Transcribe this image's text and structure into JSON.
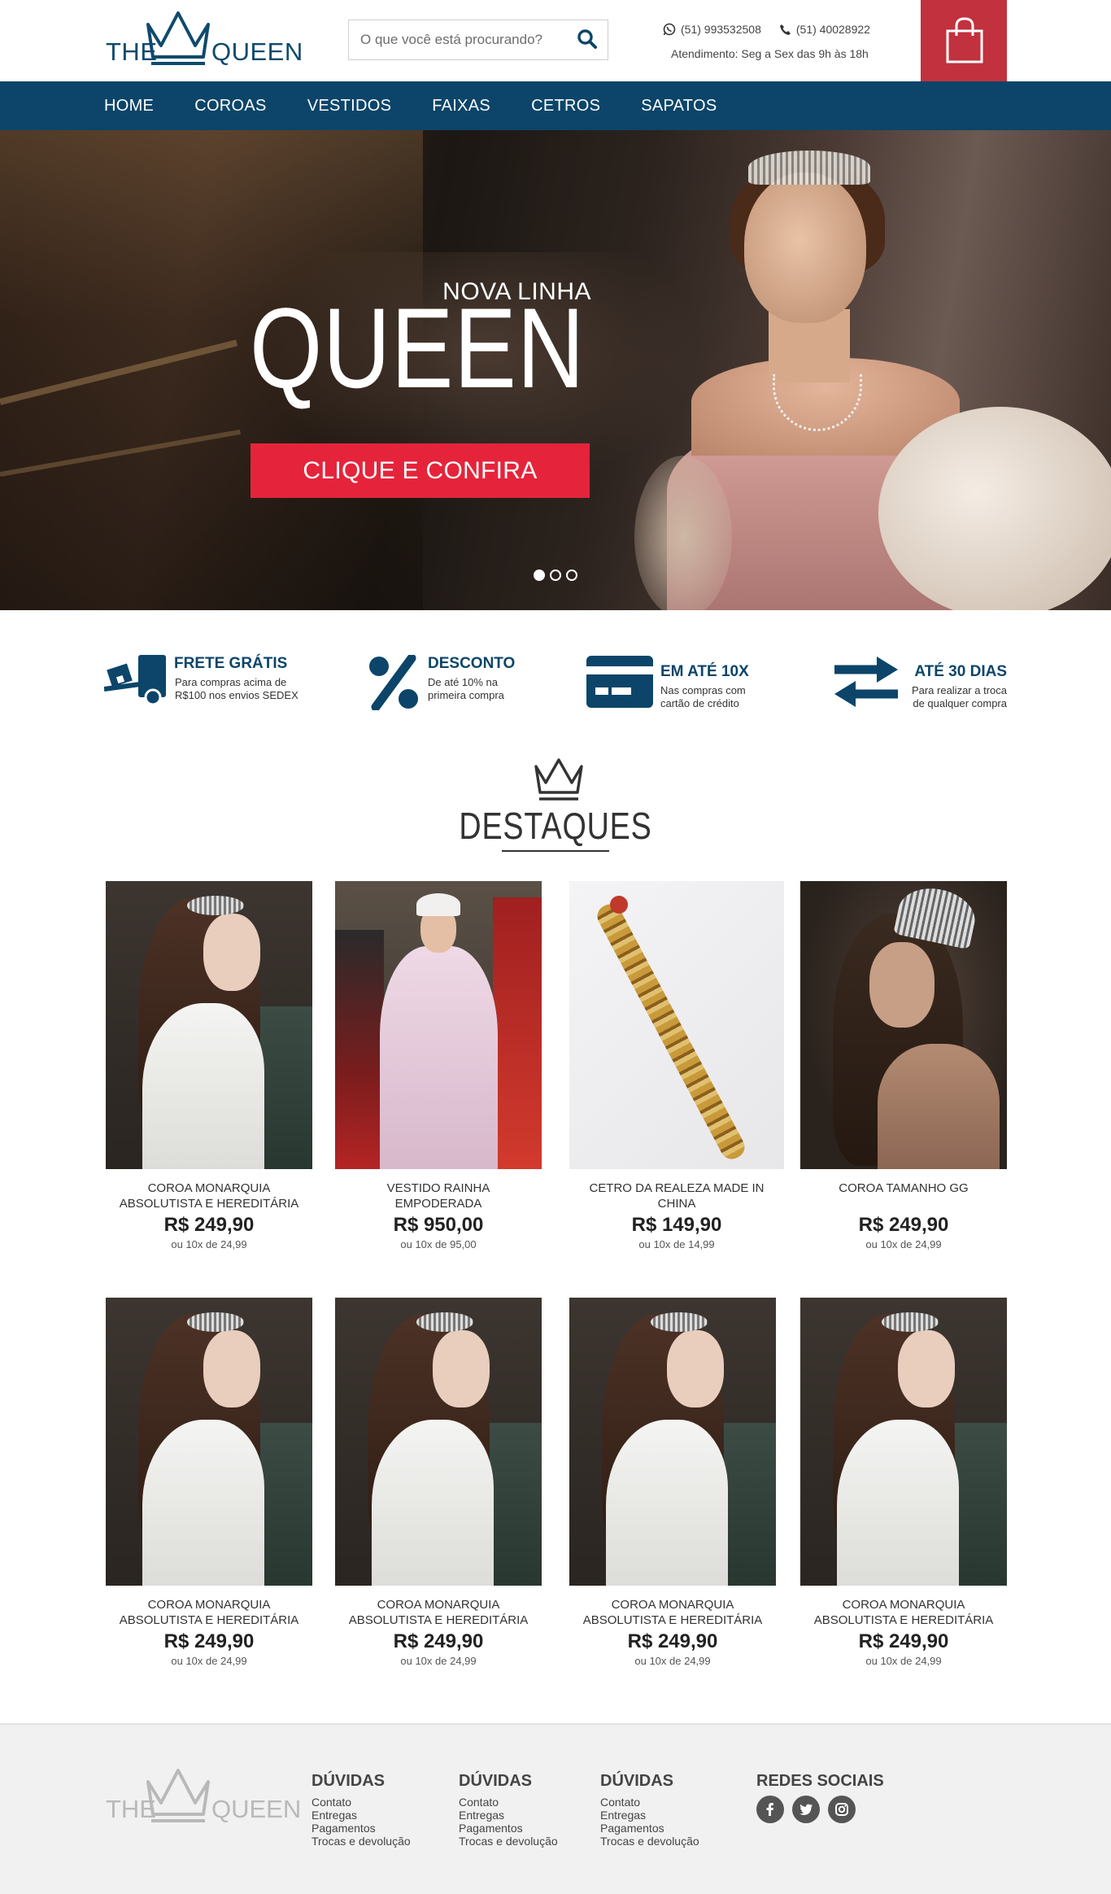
{
  "brand": {
    "logo_left": "THE",
    "logo_right": "QUEEN"
  },
  "search": {
    "placeholder": "O que você está procurando?"
  },
  "contact": {
    "whatsapp": "(51) 993532508",
    "phone": "(51) 40028922",
    "hours": "Atendimento: Seg a Sex das 9h às 18h"
  },
  "nav": {
    "items": [
      "HOME",
      "COROAS",
      "VESTIDOS",
      "FAIXAS",
      "CETROS",
      "SAPATOS"
    ]
  },
  "hero": {
    "kicker": "NOVA LINHA",
    "title": "QUEEN",
    "cta": "CLIQUE E CONFIRA",
    "slides": 3,
    "active_slide": 1
  },
  "features": [
    {
      "icon": "truck-icon",
      "title": "FRETE GRÁTIS",
      "line1": "Para compras acima de",
      "line2": "R$100 nos envios SEDEX"
    },
    {
      "icon": "percent-icon",
      "title": "DESCONTO",
      "line1": "De até 10% na",
      "line2": "primeira compra"
    },
    {
      "icon": "credit-card-icon",
      "title": "EM ATÉ 10X",
      "line1": "Nas compras com",
      "line2": "cartão de crédito"
    },
    {
      "icon": "exchange-arrows-icon",
      "title": "ATÉ 30 DIAS",
      "line1": "Para realizar a troca",
      "line2": "de qualquer compra"
    }
  ],
  "section": {
    "title": "DESTAQUES"
  },
  "products": [
    {
      "name": "COROA MONARQUIA ABSOLUTISTA E HEREDITÁRIA",
      "price": "R$ 249,90",
      "installments": "ou 10x de 24,99",
      "image": "bride"
    },
    {
      "name": "VESTIDO RAINHA EMPODERADA",
      "price": "R$ 950,00",
      "installments": "ou 10x de 95,00",
      "image": "queen"
    },
    {
      "name": "CETRO DA REALEZA MADE IN CHINA",
      "price": "R$ 149,90",
      "installments": "ou 10x de 14,99",
      "image": "scepter"
    },
    {
      "name": "COROA TAMANHO GG",
      "price": "R$ 249,90",
      "installments": "ou 10x de 24,99",
      "image": "glam"
    },
    {
      "name": "COROA MONARQUIA ABSOLUTISTA E HEREDITÁRIA",
      "price": "R$ 249,90",
      "installments": "ou 10x de 24,99",
      "image": "bride"
    },
    {
      "name": "COROA MONARQUIA ABSOLUTISTA E HEREDITÁRIA",
      "price": "R$ 249,90",
      "installments": "ou 10x de 24,99",
      "image": "bride"
    },
    {
      "name": "COROA MONARQUIA ABSOLUTISTA E HEREDITÁRIA",
      "price": "R$ 249,90",
      "installments": "ou 10x de 24,99",
      "image": "bride"
    },
    {
      "name": "COROA MONARQUIA ABSOLUTISTA E HEREDITÁRIA",
      "price": "R$ 249,90",
      "installments": "ou 10x de 24,99",
      "image": "bride"
    }
  ],
  "footer": {
    "columns": [
      {
        "title": "DÚVIDAS",
        "links": [
          "Contato",
          "Entregas",
          "Pagamentos",
          "Trocas e devolução"
        ]
      },
      {
        "title": "DÚVIDAS",
        "links": [
          "Contato",
          "Entregas",
          "Pagamentos",
          "Trocas e devolução"
        ]
      },
      {
        "title": "DÚVIDAS",
        "links": [
          "Contato",
          "Entregas",
          "Pagamentos",
          "Trocas e devolução"
        ]
      }
    ],
    "social_title": "REDES SOCIAIS",
    "social": [
      "facebook-icon",
      "twitter-icon",
      "instagram-icon"
    ]
  },
  "colors": {
    "brand_blue": "#0c4569",
    "cart_red": "#c1313e",
    "cta_red": "#e5243b",
    "footer_bg": "#f1f1f1"
  }
}
